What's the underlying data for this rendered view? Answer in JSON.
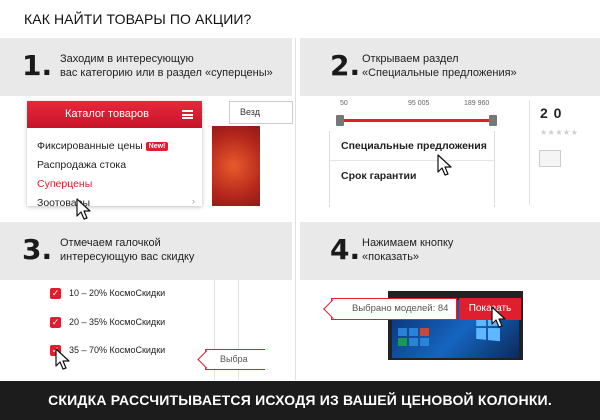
{
  "page": {
    "title": "КАК НАЙТИ ТОВАРЫ ПО АКЦИИ?",
    "footer": "СКИДКА РАССЧИТЫВАЕТСЯ ИСХОДЯ ИЗ ВАШЕЙ ЦЕНОВОЙ КОЛОНКИ."
  },
  "steps": [
    {
      "number": "1.",
      "line1": "Заходим в интересующую",
      "line2": "вас категорию или в раздел «суперцены»"
    },
    {
      "number": "2.",
      "line1": "Открываем раздел",
      "line2": "«Специальные предложения»"
    },
    {
      "number": "3.",
      "line1": "Отмечаем галочкой",
      "line2": "интересующую вас скидку"
    },
    {
      "number": "4.",
      "line1": "Нажимаем кнопку",
      "line2": "«показать»"
    }
  ],
  "panel1": {
    "catalog_title": "Каталог товаров",
    "items": [
      {
        "label": "Фиксированные цены",
        "badge": "New!"
      },
      {
        "label": "Распродажа стока"
      },
      {
        "label": "Суперцены"
      },
      {
        "label": "Зоотовары"
      }
    ],
    "search_text": "Везд"
  },
  "panel2": {
    "slider_min": "50",
    "slider_mid": "95 005",
    "slider_max": "189 960",
    "filters": [
      "Специальные предложения",
      "Срок гарантии"
    ],
    "side_price": "2 0",
    "stars": "★★★★★"
  },
  "panel3": {
    "discounts": [
      "10 – 20% КосмоСкидки",
      "20 – 35% КосмоСкидки",
      "35 – 70% КосмоСкидки"
    ],
    "tag_text": "Выбра"
  },
  "panel4": {
    "count_text": "Выбрано моделей: 84",
    "show_label": "Показать"
  },
  "colors": {
    "accent": "#e01e2e",
    "header_bg": "#e9e9e9",
    "footer_bg": "#1c1c1c"
  }
}
